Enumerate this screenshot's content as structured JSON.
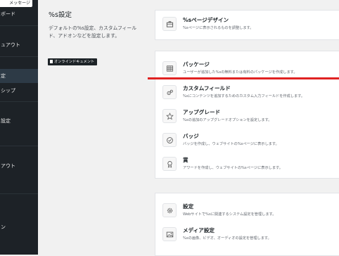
{
  "sidebar": {
    "tooltip": "メッセージ",
    "items": [
      {
        "label": "ボード"
      },
      {
        "label": "ュアウト"
      },
      {
        "label": "定"
      },
      {
        "label": "シップ"
      },
      {
        "label": "設定"
      },
      {
        "label": "アウト"
      },
      {
        "label": "ン"
      }
    ]
  },
  "intro": {
    "title": "%s設定",
    "description": "デフォルトの%s設定、カスタムフィールド、アドオンなどを設定します。",
    "doc_button": "オンラインドキュメント"
  },
  "cards": {
    "design": {
      "title": "%sページデザイン",
      "description": "%sページに表示されるものを調整します。"
    },
    "package": {
      "title": "パッケージ",
      "description": "ユーザーが追加した%sの無料または有料のパッケージを作成します。"
    },
    "custom_fields": {
      "title": "カスタムフィールド",
      "description": "%sにコンテンツを追加するためのカスタム入力フィールドを作成します。"
    },
    "upgrade": {
      "title": "アップグレード",
      "description": "%sの追加のアップグレードオプションを設定します。"
    },
    "badge": {
      "title": "バッジ",
      "description": "バッジを作成し、ウェブサイトの%sページに表示します。"
    },
    "award": {
      "title": "賞",
      "description": "アワードを作成し、ウェブサイトの%sページに表示します。"
    },
    "settings": {
      "title": "設定",
      "description": "Webサイトで%sに関連するシステム設定を管理します。"
    },
    "media": {
      "title": "メディア設定",
      "description": "%sの画像、ビデオ、オーディオの設定を管理します。"
    }
  },
  "icons": {
    "design": "briefcase-icon",
    "package": "table-icon",
    "custom_fields": "gears-icon",
    "upgrade": "star-icon",
    "badge": "check-circle-icon",
    "award": "award-icon",
    "settings": "gear-icon",
    "media": "image-icon"
  },
  "colors": {
    "sidebar_bg": "#1d2227",
    "sidebar_active": "#2d3a46",
    "annotation_line": "#e02222"
  }
}
